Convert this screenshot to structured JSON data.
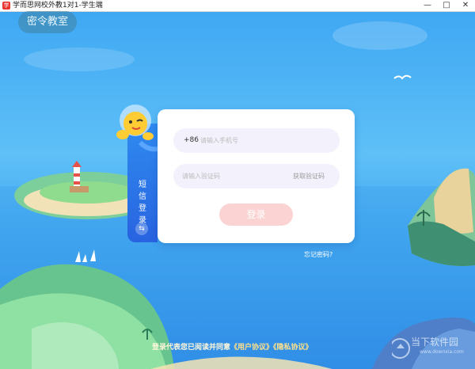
{
  "window": {
    "title": "学而思网校外教1对1-学生端",
    "app_icon": "学",
    "controls": {
      "minimize": "—",
      "maximize": "□",
      "close": "✕"
    }
  },
  "room_button": "密令教室",
  "login": {
    "tab_label": "短信登录",
    "switch_icon": "⇆",
    "country_code": "+86",
    "phone_placeholder": "请输入手机号",
    "code_placeholder": "请输入验证码",
    "get_code": "获取验证码",
    "submit": "登录",
    "forgot": "忘记密码?"
  },
  "agreement": {
    "prefix": "登录代表您已阅读并同意",
    "user_agreement": "《用户协议》",
    "privacy_agreement": "《隐私协议》"
  },
  "watermark": {
    "text": "当下软件园",
    "url": "www.downxia.com"
  },
  "colors": {
    "sky": "#4fb6f5",
    "sea": "#2a86e2",
    "tab": "#2f8bf0",
    "login_button": "#fbd3d2"
  }
}
